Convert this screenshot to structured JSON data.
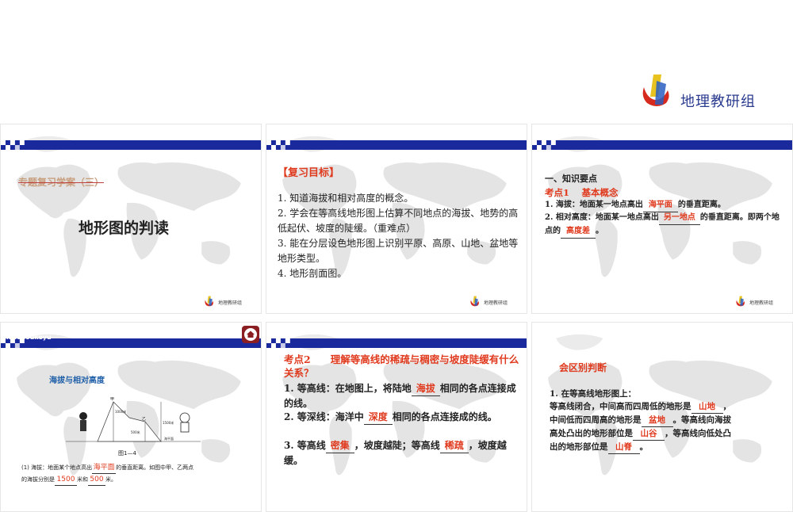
{
  "header_logo": {
    "text": "地理教研组",
    "icon": "logo-mark-icon"
  },
  "mini_logo_text": "地理教研组",
  "colors": {
    "accent_red": "#e03a1e",
    "bar_blue": "#1a2a9c",
    "map_gray": "#e3e3e3"
  },
  "slide1": {
    "subtitle": "专题复习学案（三）",
    "title": "地形图的判读"
  },
  "slide2": {
    "heading": "【复习目标】",
    "items": [
      "1. 知道海拔和相对高度的概念。",
      "2. 学会在等高线地形图上估算不同地点的海拔、地势的高低起伏、坡度的陡缓。（重难点）",
      "3. 能在分层设色地形图上识别平原、高原、山地、盆地等地形类型。",
      "4. 地形剖面图。"
    ]
  },
  "slide3": {
    "h1": "一、知识要点",
    "h2": "考点1　 基本概念",
    "p1_a": "1. 海拔：地面某一地点高出",
    "p1_fill": "海平面",
    "p1_b": "的垂直距离。",
    "p2_a": "2. 相对高度：地面某一地点高出",
    "p2_fill": "另一地点",
    "p2_b": "的垂直距离。即两个地点的",
    "p2_fill2": "高度差",
    "p2_c": "。"
  },
  "slide4": {
    "header_text": "Jiaoshoukeyu",
    "side_title": "海拔与相对高度",
    "fig_label": "图1—4",
    "diagram_labels": {
      "jia": "甲",
      "yi": "乙",
      "h1": "1000米",
      "h2": "1500米",
      "h3": "500米",
      "sea": "海平面"
    },
    "note_a": "(1) 海拔：地面某个地点高出",
    "note_fill": "海平面",
    "note_b": "的垂直距离。如图中甲、乙两点",
    "note_c": "的海拔分别是",
    "note_v1": "1500",
    "note_unit1": "米和",
    "note_v2": "500",
    "note_unit2": "米。"
  },
  "slide5": {
    "head": "考点2　　理解等高线的稀疏与稠密与坡度陡缓有什么关系？",
    "p1_a": "1. 等高线：在地图上，将陆地",
    "p1_fill": "海拔",
    "p1_b": "相同的各点连接成的线。",
    "p2_a": "2. 等深线：海洋中",
    "p2_fill": "深度",
    "p2_b": "相同的各点连接成的线。",
    "p3_a": "3. 等高线",
    "p3_fill": "密集",
    "p3_b": "，坡度越陡；等高线",
    "p3_fill2": "稀疏",
    "p3_c": "，坡度越缓。"
  },
  "slide6": {
    "head": "会区别判断",
    "l1": "1. 在等高线地形图上：",
    "l2_a": "等高线闭合，中间高而四周低的地形是",
    "l2_fill": "山地",
    "l2_b": "，",
    "l3_a": "中间低而四周高的地形是",
    "l3_fill": "盆地",
    "l3_b": "。等高线向海拔",
    "l4_a": "高处凸出的地形部位是",
    "l4_fill": "山谷",
    "l4_b": "，等高线向低处凸",
    "l5_a": "出的地形部位是",
    "l5_fill": "山脊",
    "l5_b": "。"
  }
}
